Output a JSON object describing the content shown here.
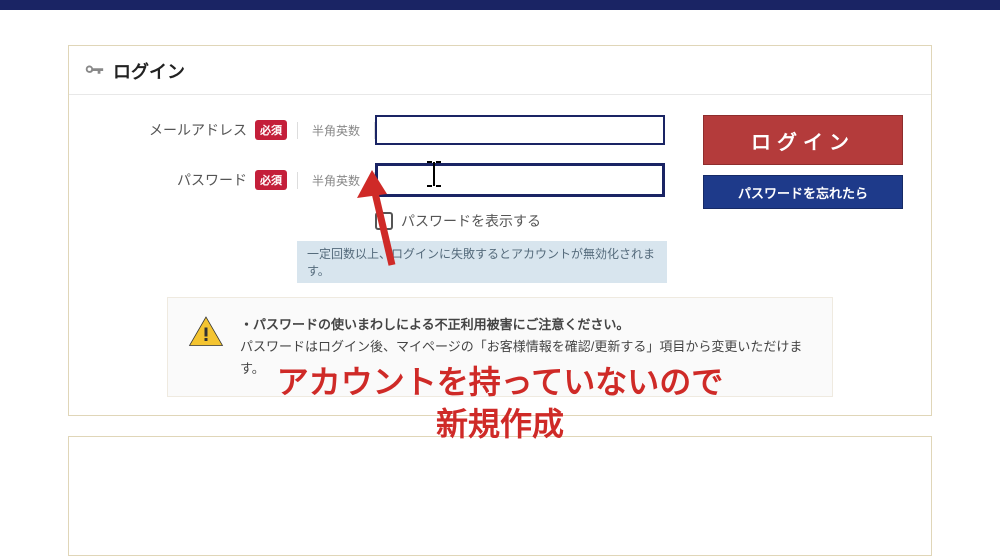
{
  "header": {
    "title": "ログイン"
  },
  "form": {
    "email": {
      "label": "メールアドレス",
      "required": "必須",
      "hint": "半角英数",
      "value": ""
    },
    "password": {
      "label": "パスワード",
      "required": "必須",
      "hint": "半角英数",
      "value": ""
    },
    "showPassword": {
      "label": "パスワードを表示する",
      "checked": false
    },
    "lockoutNotice": "一定回数以上、ログインに失敗するとアカウントが無効化されます。"
  },
  "buttons": {
    "login": "ログイン",
    "forgot": "パスワードを忘れたら"
  },
  "warning": {
    "line1": "・パスワードの使いまわしによる不正利用被害にご注意ください。",
    "line2": "パスワードはログイン後、マイページの「お客様情報を確認/更新する」項目から変更いただけます。"
  },
  "annotation": {
    "line1": "アカウントを持っていないので",
    "line2": "新規作成"
  },
  "colors": {
    "navy": "#1a2464",
    "loginRed": "#b43b3b",
    "forgotBlue": "#1e3a8a",
    "annotRed": "#cf2a27",
    "requiredBadge": "#c41f3a"
  }
}
